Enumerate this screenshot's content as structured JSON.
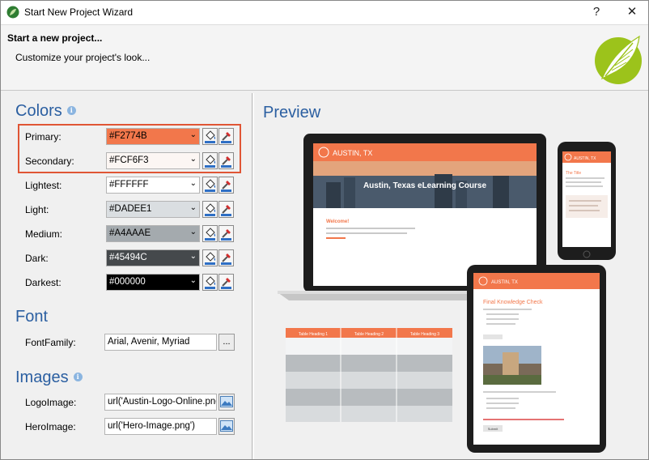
{
  "window": {
    "title": "Start New Project Wizard",
    "help_label": "?",
    "close_label": "✕"
  },
  "header": {
    "title": "Start a new project...",
    "subtitle": "Customize your project's look..."
  },
  "colors": {
    "heading": "Colors",
    "info_glyph": "i",
    "rows": [
      {
        "label": "Primary:",
        "value": "#F2774B",
        "color": "#F2774B",
        "text_color": "#000000"
      },
      {
        "label": "Secondary:",
        "value": "#FCF6F3",
        "color": "#FCF6F3",
        "text_color": "#000000"
      },
      {
        "label": "Lightest:",
        "value": "#FFFFFF",
        "color": "#FFFFFF",
        "text_color": "#000000"
      },
      {
        "label": "Light:",
        "value": "#DADEE1",
        "color": "#DADEE1",
        "text_color": "#000000"
      },
      {
        "label": "Medium:",
        "value": "#A4AAAE",
        "color": "#A4AAAE",
        "text_color": "#000000"
      },
      {
        "label": "Dark:",
        "value": "#45494C",
        "color": "#45494C",
        "text_color": "#FFFFFF"
      },
      {
        "label": "Darkest:",
        "value": "#000000",
        "color": "#000000",
        "text_color": "#FFFFFF"
      }
    ]
  },
  "font": {
    "heading": "Font",
    "family_label": "FontFamily:",
    "family_value": "Arial, Avenir, Myriad",
    "browse_label": "..."
  },
  "images": {
    "heading": "Images",
    "info_glyph": "i",
    "logo_label": "LogoImage:",
    "logo_value": "url('Austin-Logo-Online.png')",
    "hero_label": "HeroImage:",
    "hero_value": "url('Hero-Image.png')"
  },
  "preview": {
    "heading": "Preview",
    "laptop": {
      "brand": "AUSTIN, TX",
      "hero_title": "Austin, Texas eLearning Course",
      "welcome": "Welcome!"
    },
    "phone": {
      "brand": "AUSTIN, TX",
      "heading": "The Title"
    },
    "tablet": {
      "brand": "AUSTIN, TX",
      "heading": "Final Knowledge Check",
      "button": "Submit"
    },
    "table": {
      "headers": [
        "Table Heading 1",
        "Table Heading 2",
        "Table Heading 3"
      ]
    }
  },
  "accent_color": "#F2774B",
  "brand_green": "#9cc31b"
}
